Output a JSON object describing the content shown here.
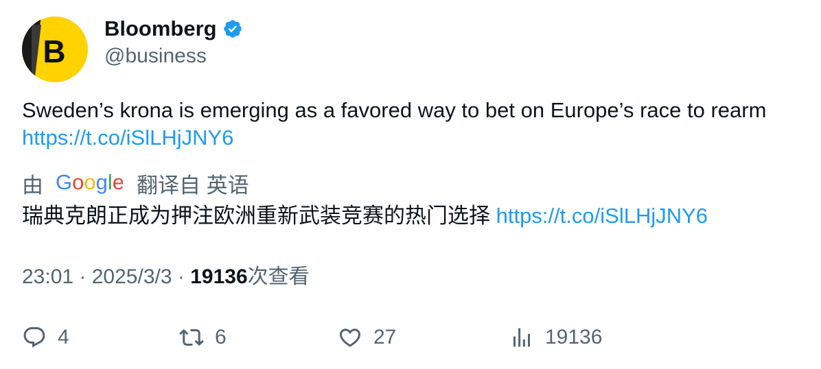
{
  "author": {
    "name": "Bloomberg",
    "handle": "@business",
    "avatar_letter": "B",
    "verified": true
  },
  "tweet": {
    "text": "Sweden’s krona is emerging as a favored way to bet on Europe’s race to rearm",
    "link": "https://t.co/iSlLHjJNY6"
  },
  "translation": {
    "by_label": "由",
    "provider": "Google",
    "from_label": "翻译自 英语",
    "text": "瑞典克朗正成为押注欧洲重新武装竞赛的热门选择",
    "link": "https://t.co/iSlLHjJNY6"
  },
  "meta": {
    "time": "23:01",
    "separator": " · ",
    "date": "2025/3/3",
    "views": "19136",
    "views_suffix": "次查看"
  },
  "actions": {
    "replies": "4",
    "retweets": "6",
    "likes": "27",
    "views": "19136"
  },
  "colors": {
    "link": "#1d9bf0",
    "muted": "#536471",
    "text": "#0f1419",
    "avatar_yellow": "#ffd700",
    "verified_blue": "#1d9bf0"
  },
  "icons": [
    "verified-badge-icon",
    "reply-icon",
    "retweet-icon",
    "like-icon",
    "views-icon",
    "google-logo"
  ]
}
